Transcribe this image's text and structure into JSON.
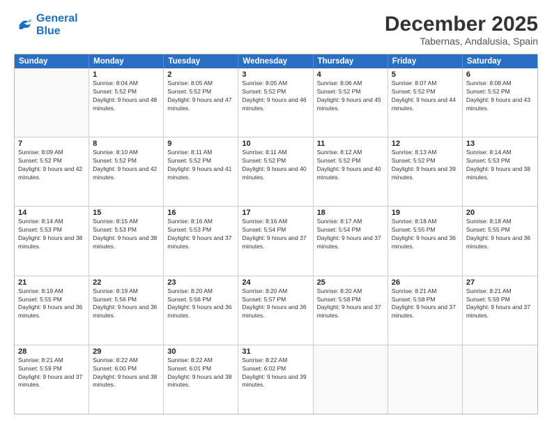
{
  "header": {
    "logo_line1": "General",
    "logo_line2": "Blue",
    "month_year": "December 2025",
    "location": "Tabernas, Andalusia, Spain"
  },
  "weekdays": [
    "Sunday",
    "Monday",
    "Tuesday",
    "Wednesday",
    "Thursday",
    "Friday",
    "Saturday"
  ],
  "rows": [
    [
      {
        "day": "",
        "sunrise": "",
        "sunset": "",
        "daylight": ""
      },
      {
        "day": "1",
        "sunrise": "8:04 AM",
        "sunset": "5:52 PM",
        "daylight": "9 hours and 48 minutes."
      },
      {
        "day": "2",
        "sunrise": "8:05 AM",
        "sunset": "5:52 PM",
        "daylight": "9 hours and 47 minutes."
      },
      {
        "day": "3",
        "sunrise": "8:05 AM",
        "sunset": "5:52 PM",
        "daylight": "9 hours and 46 minutes."
      },
      {
        "day": "4",
        "sunrise": "8:06 AM",
        "sunset": "5:52 PM",
        "daylight": "9 hours and 45 minutes."
      },
      {
        "day": "5",
        "sunrise": "8:07 AM",
        "sunset": "5:52 PM",
        "daylight": "9 hours and 44 minutes."
      },
      {
        "day": "6",
        "sunrise": "8:08 AM",
        "sunset": "5:52 PM",
        "daylight": "9 hours and 43 minutes."
      }
    ],
    [
      {
        "day": "7",
        "sunrise": "8:09 AM",
        "sunset": "5:52 PM",
        "daylight": "9 hours and 42 minutes."
      },
      {
        "day": "8",
        "sunrise": "8:10 AM",
        "sunset": "5:52 PM",
        "daylight": "9 hours and 42 minutes."
      },
      {
        "day": "9",
        "sunrise": "8:11 AM",
        "sunset": "5:52 PM",
        "daylight": "9 hours and 41 minutes."
      },
      {
        "day": "10",
        "sunrise": "8:11 AM",
        "sunset": "5:52 PM",
        "daylight": "9 hours and 40 minutes."
      },
      {
        "day": "11",
        "sunrise": "8:12 AM",
        "sunset": "5:52 PM",
        "daylight": "9 hours and 40 minutes."
      },
      {
        "day": "12",
        "sunrise": "8:13 AM",
        "sunset": "5:52 PM",
        "daylight": "9 hours and 39 minutes."
      },
      {
        "day": "13",
        "sunrise": "8:14 AM",
        "sunset": "5:53 PM",
        "daylight": "9 hours and 38 minutes."
      }
    ],
    [
      {
        "day": "14",
        "sunrise": "8:14 AM",
        "sunset": "5:53 PM",
        "daylight": "9 hours and 38 minutes."
      },
      {
        "day": "15",
        "sunrise": "8:15 AM",
        "sunset": "5:53 PM",
        "daylight": "9 hours and 38 minutes."
      },
      {
        "day": "16",
        "sunrise": "8:16 AM",
        "sunset": "5:53 PM",
        "daylight": "9 hours and 37 minutes."
      },
      {
        "day": "17",
        "sunrise": "8:16 AM",
        "sunset": "5:54 PM",
        "daylight": "9 hours and 37 minutes."
      },
      {
        "day": "18",
        "sunrise": "8:17 AM",
        "sunset": "5:54 PM",
        "daylight": "9 hours and 37 minutes."
      },
      {
        "day": "19",
        "sunrise": "8:18 AM",
        "sunset": "5:55 PM",
        "daylight": "9 hours and 36 minutes."
      },
      {
        "day": "20",
        "sunrise": "8:18 AM",
        "sunset": "5:55 PM",
        "daylight": "9 hours and 36 minutes."
      }
    ],
    [
      {
        "day": "21",
        "sunrise": "8:19 AM",
        "sunset": "5:55 PM",
        "daylight": "9 hours and 36 minutes."
      },
      {
        "day": "22",
        "sunrise": "8:19 AM",
        "sunset": "5:56 PM",
        "daylight": "9 hours and 36 minutes."
      },
      {
        "day": "23",
        "sunrise": "8:20 AM",
        "sunset": "5:56 PM",
        "daylight": "9 hours and 36 minutes."
      },
      {
        "day": "24",
        "sunrise": "8:20 AM",
        "sunset": "5:57 PM",
        "daylight": "9 hours and 36 minutes."
      },
      {
        "day": "25",
        "sunrise": "8:20 AM",
        "sunset": "5:58 PM",
        "daylight": "9 hours and 37 minutes."
      },
      {
        "day": "26",
        "sunrise": "8:21 AM",
        "sunset": "5:58 PM",
        "daylight": "9 hours and 37 minutes."
      },
      {
        "day": "27",
        "sunrise": "8:21 AM",
        "sunset": "5:59 PM",
        "daylight": "9 hours and 37 minutes."
      }
    ],
    [
      {
        "day": "28",
        "sunrise": "8:21 AM",
        "sunset": "5:59 PM",
        "daylight": "9 hours and 37 minutes."
      },
      {
        "day": "29",
        "sunrise": "8:22 AM",
        "sunset": "6:00 PM",
        "daylight": "9 hours and 38 minutes."
      },
      {
        "day": "30",
        "sunrise": "8:22 AM",
        "sunset": "6:01 PM",
        "daylight": "9 hours and 38 minutes."
      },
      {
        "day": "31",
        "sunrise": "8:22 AM",
        "sunset": "6:02 PM",
        "daylight": "9 hours and 39 minutes."
      },
      {
        "day": "",
        "sunrise": "",
        "sunset": "",
        "daylight": ""
      },
      {
        "day": "",
        "sunrise": "",
        "sunset": "",
        "daylight": ""
      },
      {
        "day": "",
        "sunrise": "",
        "sunset": "",
        "daylight": ""
      }
    ]
  ]
}
